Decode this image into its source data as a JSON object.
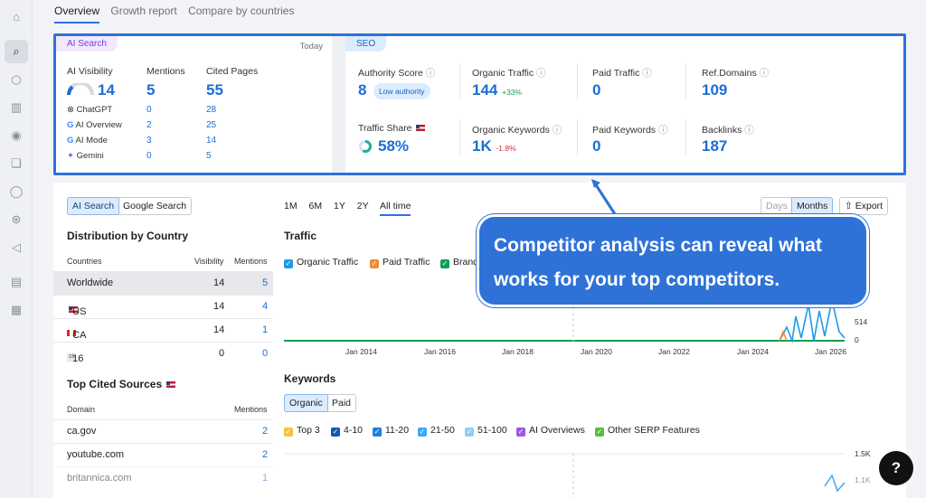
{
  "tabs": [
    "Overview",
    "Growth report",
    "Compare by countries"
  ],
  "ai": {
    "pill": "AI Search",
    "today": "Today",
    "headers": [
      "AI Visibility",
      "Mentions",
      "Cited Pages"
    ],
    "totals": [
      "14",
      "5",
      "55"
    ],
    "rows": [
      {
        "name": "ChatGPT",
        "m": "0",
        "c": "28"
      },
      {
        "name": "AI Overview",
        "m": "2",
        "c": "25"
      },
      {
        "name": "AI Mode",
        "m": "3",
        "c": "14"
      },
      {
        "name": "Gemini",
        "m": "0",
        "c": "5"
      }
    ]
  },
  "seo": {
    "pill": "SEO",
    "metrics": [
      {
        "label": "Authority Score",
        "value": "8",
        "badge": "Low authority"
      },
      {
        "label": "Organic Traffic",
        "value": "144",
        "delta": "+33%"
      },
      {
        "label": "Paid Traffic",
        "value": "0"
      },
      {
        "label": "Ref.Domains",
        "value": "109"
      },
      {
        "label": "Traffic Share",
        "value": "58%"
      },
      {
        "label": "Organic Keywords",
        "value": "1K",
        "delta": "-1.8%"
      },
      {
        "label": "Paid Keywords",
        "value": "0"
      },
      {
        "label": "Backlinks",
        "value": "187"
      }
    ]
  },
  "left": {
    "toggle": [
      "AI Search",
      "Google Search"
    ],
    "dist_title": "Distribution by Country",
    "dist_headers": [
      "Countries",
      "Visibility",
      "Mentions"
    ],
    "dist_rows": [
      {
        "c": "Worldwide",
        "v": "14",
        "m": "5"
      },
      {
        "c": "US",
        "v": "14",
        "m": "4"
      },
      {
        "c": "CA",
        "v": "14",
        "m": "1"
      },
      {
        "c": "16",
        "v": "0",
        "m": "0"
      }
    ],
    "cited_title": "Top Cited Sources",
    "cited_headers": [
      "Domain",
      "Mentions"
    ],
    "cited_rows": [
      {
        "d": "ca.gov",
        "m": "2"
      },
      {
        "d": "youtube.com",
        "m": "2"
      },
      {
        "d": "britannica.com",
        "m": "1"
      }
    ]
  },
  "chart": {
    "ranges": [
      "1M",
      "6M",
      "1Y",
      "2Y",
      "All time"
    ],
    "days": "Days",
    "months": "Months",
    "export": "Export",
    "traffic_title": "Traffic",
    "traffic_legend": [
      "Organic Traffic",
      "Paid Traffic",
      "Brand"
    ],
    "y_ticks": [
      "514",
      "0"
    ],
    "x_ticks": [
      "Jan 2014",
      "Jan 2016",
      "Jan 2018",
      "Jan 2020",
      "Jan 2022",
      "Jan 2024",
      "Jan 2026"
    ],
    "kw_title": "Keywords",
    "kw_toggle": [
      "Organic",
      "Paid"
    ],
    "kw_legend": [
      "Top 3",
      "4-10",
      "11-20",
      "21-50",
      "51-100",
      "AI Overviews",
      "Other SERP Features"
    ],
    "kw_y": [
      "1.5K",
      "1.1K"
    ]
  },
  "colors": {
    "organic": "#1e9be6",
    "paid": "#ee8d32",
    "brand": "#119e55"
  },
  "callout": {
    "line1": "Competitor analysis can reveal what",
    "line2": "works for your top competitors."
  },
  "help": "?"
}
